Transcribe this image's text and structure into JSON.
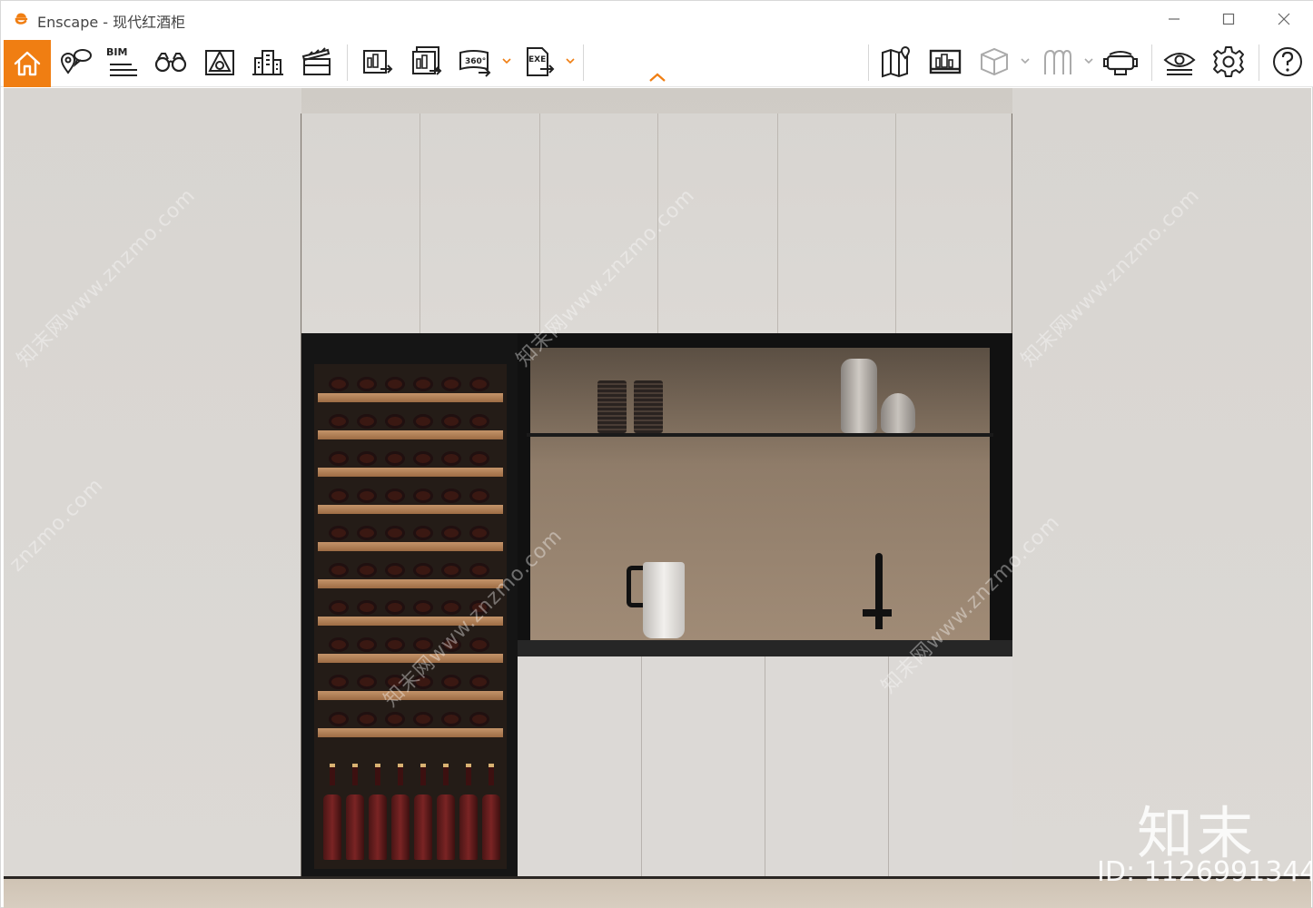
{
  "window": {
    "title": "Enscape - 现代红酒柜",
    "controls": [
      "minimize",
      "maximize",
      "close"
    ]
  },
  "toolbar": {
    "bim_label": "BIM",
    "pano_label": "360°",
    "exe_label": "EXE",
    "accent": "#f07e12",
    "left_icons": [
      "home-icon",
      "location-views-icon",
      "bim-icon",
      "binoculars-icon",
      "asset-library-icon",
      "site-context-icon",
      "video-editor-icon"
    ],
    "export_icons": [
      "screenshot-export-icon",
      "batch-render-icon",
      "panorama-export-icon",
      "exe-export-icon"
    ],
    "right_icons": [
      "map-icon",
      "views-icon",
      "cube-icon",
      "atmosphere-icon",
      "vr-headset-icon",
      "visibility-icon",
      "settings-icon",
      "help-icon"
    ]
  },
  "watermarks": {
    "site": "知末网www.znzmo.com",
    "site_short": "znzmo.com",
    "brand": "知末",
    "id": "ID: 1126991344"
  }
}
